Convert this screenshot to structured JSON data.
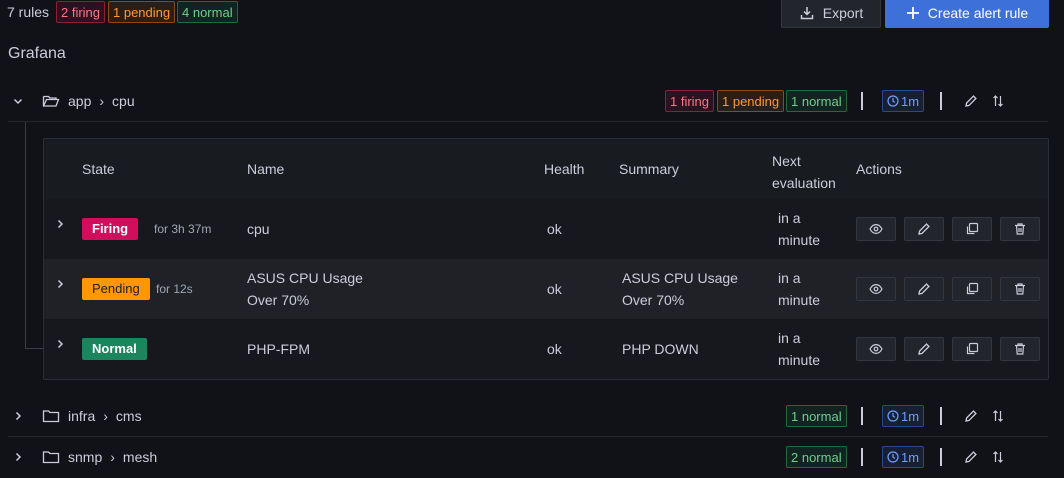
{
  "summary": {
    "rules_count": "7 rules",
    "firing": "2 firing",
    "pending": "1 pending",
    "normal": "4 normal"
  },
  "toolbar": {
    "export_label": "Export",
    "create_label": "Create alert rule"
  },
  "namespace": "Grafana",
  "groups": [
    {
      "folder": "app",
      "name": "cpu",
      "badges": {
        "firing": "1 firing",
        "pending": "1 pending",
        "normal": "1 normal"
      },
      "interval": "1m",
      "expanded": true
    },
    {
      "folder": "infra",
      "name": "cms",
      "badges": {
        "normal": "1 normal"
      },
      "interval": "1m",
      "expanded": false
    },
    {
      "folder": "snmp",
      "name": "mesh",
      "badges": {
        "normal": "2 normal"
      },
      "interval": "1m",
      "expanded": false
    }
  ],
  "table": {
    "headers": {
      "state": "State",
      "name": "Name",
      "health": "Health",
      "summary": "Summary",
      "next_eval_line1": "Next",
      "next_eval_line2": "evaluation",
      "actions": "Actions"
    },
    "rows": [
      {
        "state": "Firing",
        "duration": "for 3h 37m",
        "name_line1": "cpu",
        "name_line2": "",
        "health": "ok",
        "summary_line1": "",
        "summary_line2": "",
        "next_line1": "in a",
        "next_line2": "minute"
      },
      {
        "state": "Pending",
        "duration": "for 12s",
        "name_line1": "ASUS CPU Usage",
        "name_line2": "Over 70%",
        "health": "ok",
        "summary_line1": "ASUS CPU Usage",
        "summary_line2": "Over 70%",
        "next_line1": "in a",
        "next_line2": "minute"
      },
      {
        "state": "Normal",
        "duration": "",
        "name_line1": "PHP-FPM",
        "name_line2": "",
        "health": "ok",
        "summary_line1": "PHP DOWN",
        "summary_line2": "",
        "next_line1": "in a",
        "next_line2": "minute"
      }
    ]
  },
  "icons": {
    "export": "download-icon",
    "create": "plus-icon",
    "folder_open": "folder-open-icon",
    "folder": "folder-icon",
    "clock": "clock-icon",
    "edit": "pen-icon",
    "sort": "sort-icon",
    "view": "eye-icon",
    "copy": "copy-icon",
    "delete": "trash-icon"
  },
  "colors": {
    "firing": "#d10e5c",
    "pending": "#ff9800",
    "normal": "#1b855e",
    "primary": "#3d71d9"
  }
}
